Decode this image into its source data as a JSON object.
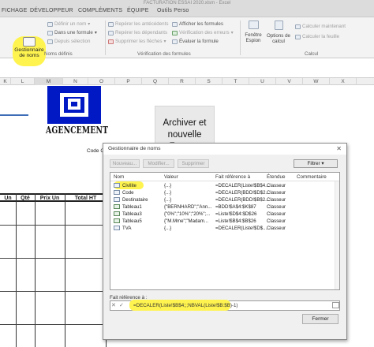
{
  "window": {
    "title": "FACTURATION ESSAI 2020.xlsm - Excel"
  },
  "tabs": [
    "FICHAGE",
    "DÉVELOPPEUR",
    "COMPLÉMENTS",
    "ÉQUIPE",
    "Outils Perso"
  ],
  "ribbon": {
    "gestionnaire_label": "Gestionnaire de noms",
    "noms_definis": {
      "definir_nom": "Définir un nom",
      "dans_formule": "Dans une formule",
      "depuis_selection": "Depuis sélection",
      "group_label": "Noms définis"
    },
    "verification": {
      "reperer_antecedents": "Repérer les antécédents",
      "reperer_dependants": "Repérer les dépendants",
      "supprimer_fleches": "Supprimer les flèches",
      "afficher_formules": "Afficher les formules",
      "verification_erreurs": "Vérification des erreurs",
      "evaluer_formule": "Évaluer la formule",
      "group_label": "Vérification des formules"
    },
    "fenetre_espion": "Fenêtre Espion",
    "options_calcul": "Options de calcul",
    "calculer_maintenant": "Calculer maintenant",
    "calculer_feuille": "Calculer la feuille",
    "calcul_label": "Calcul"
  },
  "sheet": {
    "columns": [
      "K",
      "L",
      "M",
      "N",
      "O",
      "P",
      "Q",
      "R",
      "S",
      "T",
      "U",
      "V",
      "W",
      "X"
    ],
    "logo_text": "AGENCEMENT",
    "code_client": "Code Cl",
    "archive_button": "Archiver et nouvelle Facture",
    "table_headers": [
      "Un",
      "Qté",
      "Prix Un",
      "Total HT"
    ]
  },
  "dialog": {
    "title": "Gestionnaire de noms",
    "buttons": {
      "nouveau": "Nouveau...",
      "modifier": "Modifier...",
      "supprimer": "Supprimer",
      "filtrer": "Filtrer"
    },
    "columns": [
      "Nom",
      "Valeur",
      "Fait référence à",
      "Étendue",
      "Commentaire"
    ],
    "names": [
      {
        "nom": "Civilite",
        "valeur": "{...}",
        "ref": "=DECALER(Liste!$B$4...",
        "etendue": "Classeur",
        "type": "name"
      },
      {
        "nom": "Code",
        "valeur": "{...}",
        "ref": "=DECALER(BDD!$D$2...",
        "etendue": "Classeur",
        "type": "name"
      },
      {
        "nom": "Destinataire",
        "valeur": "{...}",
        "ref": "=DECALER(BDD!$B$2...",
        "etendue": "Classeur",
        "type": "name"
      },
      {
        "nom": "Tableau1",
        "valeur": "{\"BERNHARD\";\"Ann...",
        "ref": "=BDD!$A$4:$K$87",
        "etendue": "Classeur",
        "type": "table"
      },
      {
        "nom": "Tableau3",
        "valeur": "{\"0%\";\"10%\";\"20%\";...",
        "ref": "=Liste!$D$4:$D$26",
        "etendue": "Classeur",
        "type": "table"
      },
      {
        "nom": "Tableau5",
        "valeur": "{\"M.Mme\";\"Madam...",
        "ref": "=Liste!$B$4:$B$26",
        "etendue": "Classeur",
        "type": "table"
      },
      {
        "nom": "TVA",
        "valeur": "{...}",
        "ref": "=DECALER(Liste!$D$...",
        "etendue": "Classeur",
        "type": "name"
      }
    ],
    "fait_reference_label": "Fait référence à :",
    "fait_reference_value": "=DECALER(Liste!$B$4;;;NBVAL(Liste!$B:$B)-1)",
    "fermer": "Fermer"
  },
  "highlight_color": "#fff44f"
}
